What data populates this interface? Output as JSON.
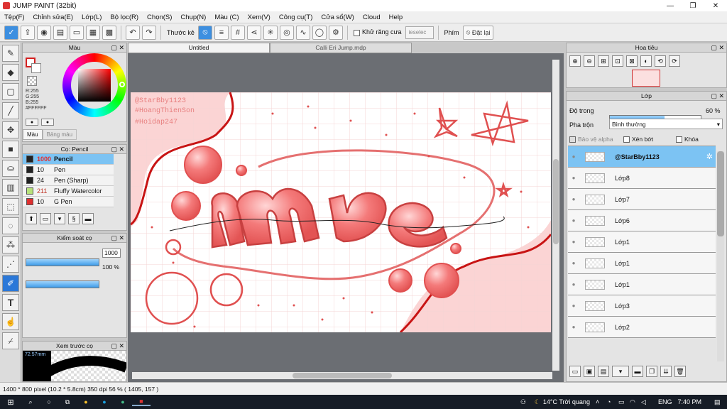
{
  "app": {
    "title": "JUMP PAINT (32bit)",
    "win": [
      "—",
      "❐",
      "✕"
    ]
  },
  "menu": [
    "Tệp(F)",
    "Chỉnh sửa(E)",
    "Lớp(L)",
    "Bộ lọc(R)",
    "Chọn(S)",
    "Chụp(N)",
    "Màu (C)",
    "Xem(V)",
    "Công cụ(T)",
    "Cửa sổ(W)",
    "Cloud",
    "Help"
  ],
  "toolbar": {
    "fill_label": "Thước kẻ",
    "anti_label": "Khử răng cưa",
    "select_placeholder": "ieselec",
    "key_label": "Phím",
    "reset_label": "Đặt lại"
  },
  "color_panel": {
    "title": "Màu",
    "rgb": "R:255\nG:255\nB:255",
    "hex": "#FFFFFF",
    "tab1": "Màu",
    "tab2": "Bảng màu",
    "primary": "#ffffff",
    "outline": "#d42020"
  },
  "brush_panel": {
    "title": "Cọ: Pencil",
    "brushes": [
      {
        "size": "1000",
        "name": "Pencil",
        "color": "#222222",
        "sizecolor": "#e03030"
      },
      {
        "size": "10",
        "name": "Pen",
        "color": "#222222",
        "sizecolor": "#111111"
      },
      {
        "size": "24",
        "name": "Pen (Sharp)",
        "color": "#222222",
        "sizecolor": "#111111"
      },
      {
        "size": "211",
        "name": "Fluffy Watercolor",
        "color": "#b7e27a",
        "sizecolor": "#c0392b"
      },
      {
        "size": "10",
        "name": "G Pen",
        "color": "#e03030",
        "sizecolor": "#111111"
      }
    ]
  },
  "brush_ctrl": {
    "title": "Kiểm soát cọ",
    "size_val": "1000",
    "size_frac": 1.0,
    "op_val": "100 %",
    "op_frac": 1.0
  },
  "preview": {
    "title": "Xem trước cọ",
    "size": "72.57mm"
  },
  "tabs": {
    "tab1": "Untitled",
    "tab2": "Calli Eri Jump.mdp"
  },
  "nav": {
    "title": "Hoa tiêu"
  },
  "layers": {
    "title": "Lớp",
    "opacity_label": "Độ trong",
    "opacity_val": "60 %",
    "opacity_frac": 0.6,
    "blend_label": "Pha trộn",
    "blend_val": "Bình thường",
    "protect_label": "Bảo vệ alpha",
    "clip_label": "Xén bớt",
    "lock_label": "Khóa",
    "items": [
      "@StarBby1123",
      "Lớp8",
      "Lớp7",
      "Lớp6",
      "Lớp1",
      "Lớp1",
      "Lớp1",
      "Lớp3",
      "Lớp2"
    ]
  },
  "status": "1400 * 800 pixel   (10.2 * 5.8cm)  350 dpi  56 %  ( 1405, 157 )",
  "art": {
    "handle1": "@StarBby1123",
    "handle2": "#HoangThienSon",
    "handle3": "#Hoidap247",
    "word": "mê"
  },
  "taskbar": {
    "weather": "14°C  Trời quang",
    "lang": "ENG",
    "time": "7:40 PM"
  }
}
